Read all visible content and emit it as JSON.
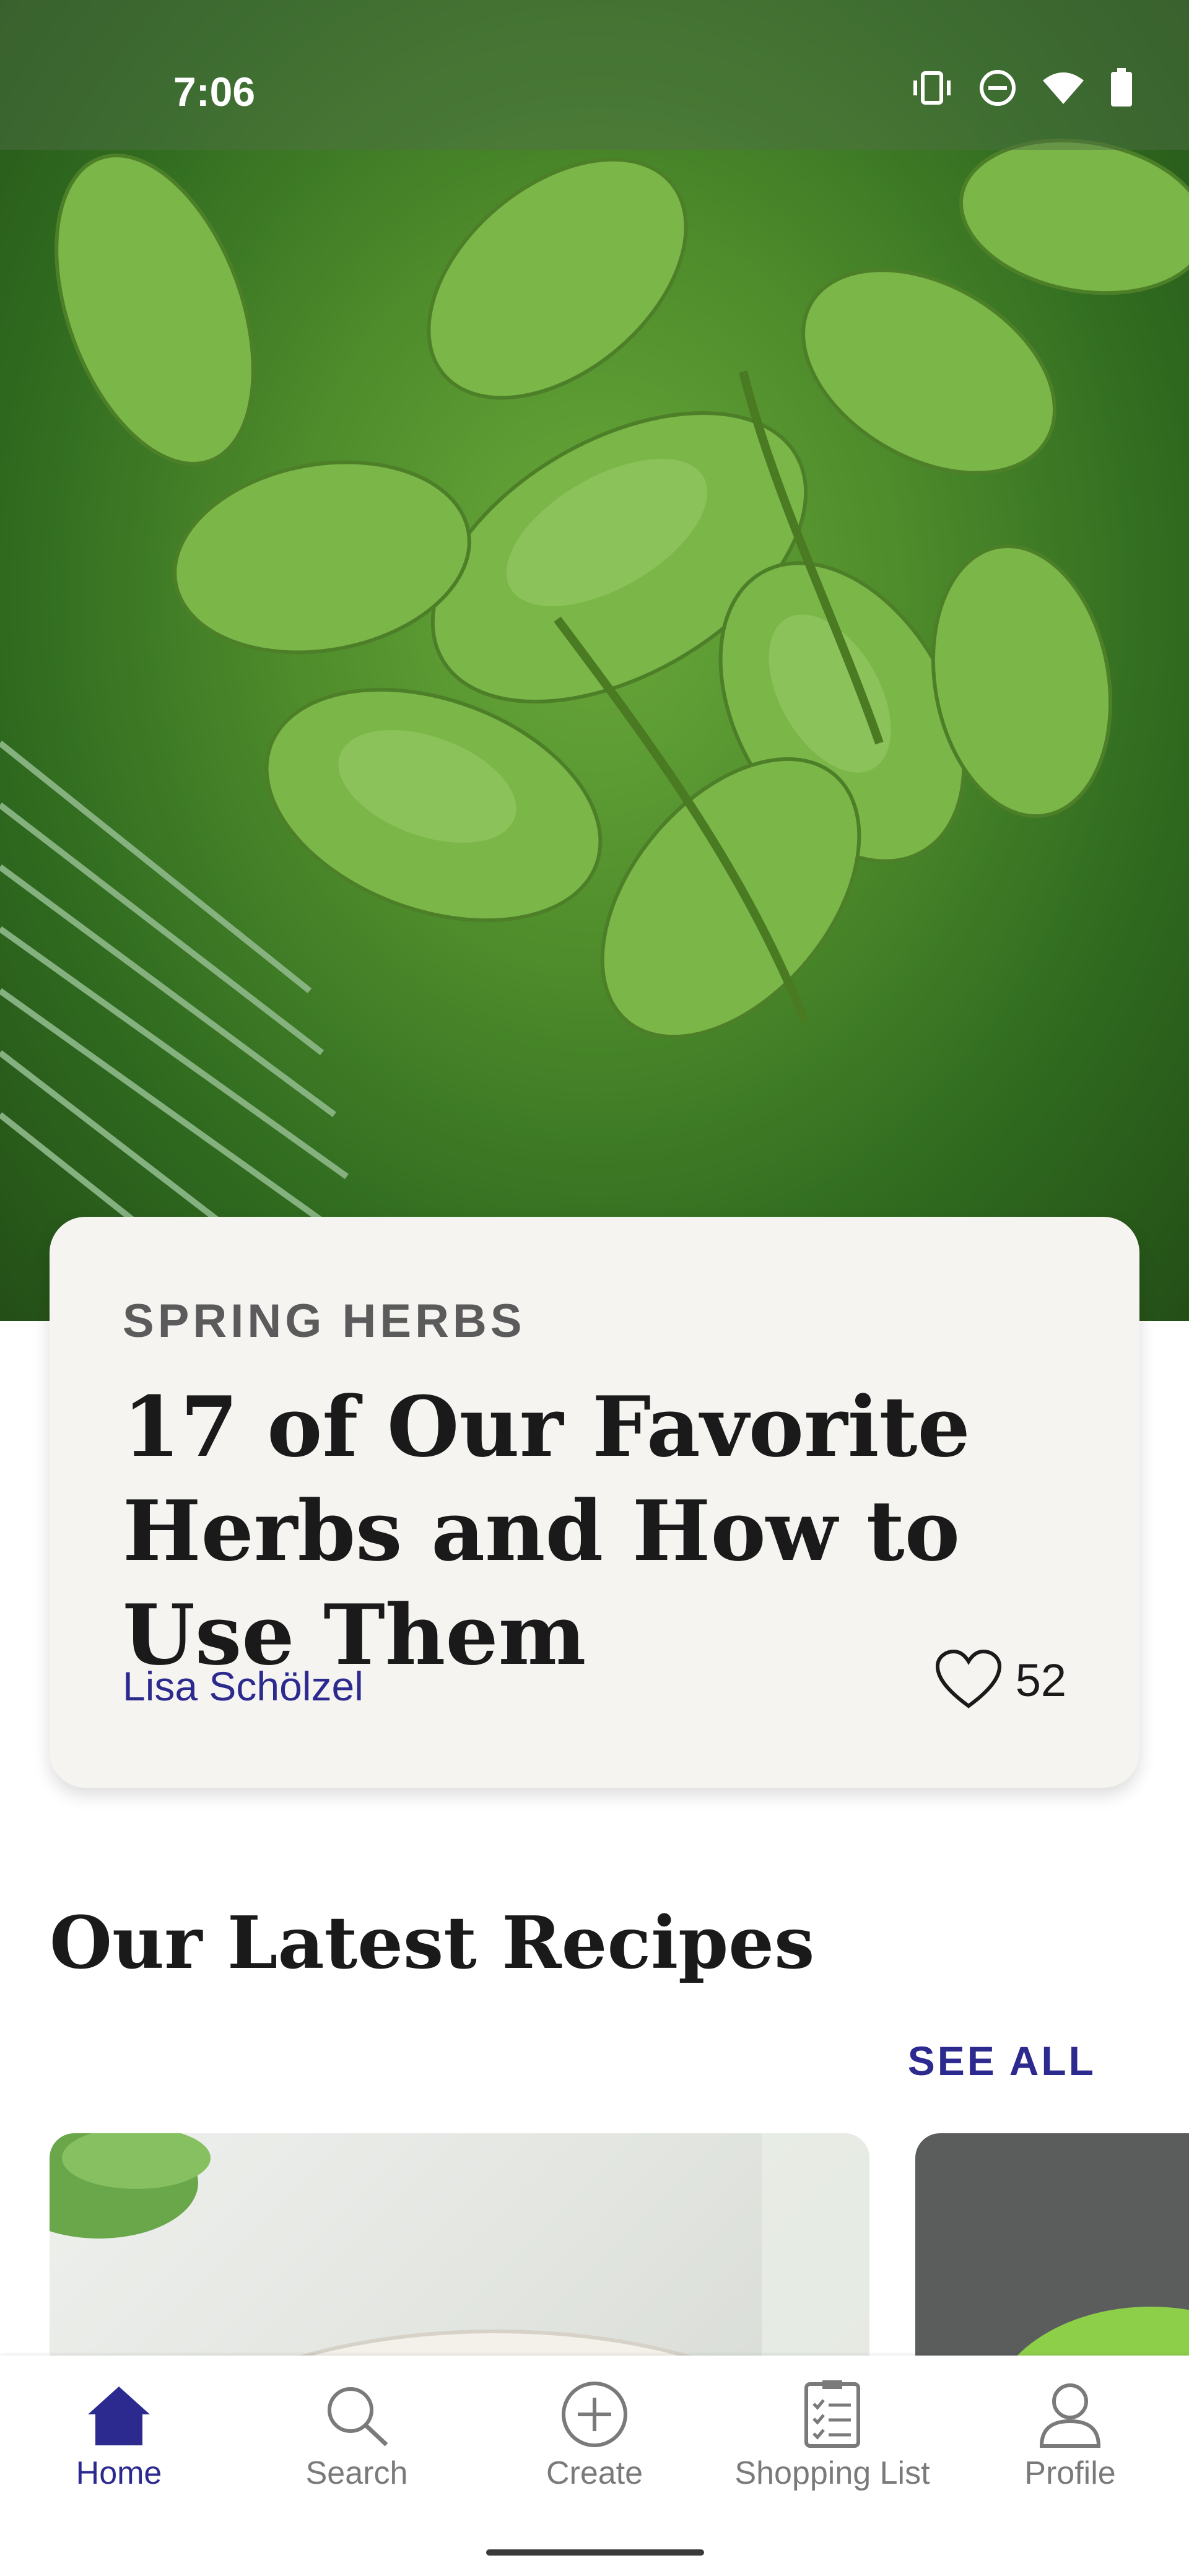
{
  "status_bar": {
    "time": "7:06",
    "icons": [
      "vibrate-icon",
      "do-not-disturb-icon",
      "wifi-icon",
      "battery-icon"
    ]
  },
  "hero": {
    "image": "herbs-photo"
  },
  "feature_card": {
    "kicker": "SPRING HERBS",
    "title": "17 of Our Favorite Herbs and How to Use Them",
    "author": "Lisa Schölzel",
    "like_count": "52",
    "like_icon": "heart-outline-icon"
  },
  "latest": {
    "title": "Our Latest Recipes",
    "see_all": "SEE ALL"
  },
  "bottom_nav": {
    "items": [
      {
        "label": "Home",
        "icon": "home-icon",
        "active": true
      },
      {
        "label": "Search",
        "icon": "search-icon",
        "active": false
      },
      {
        "label": "Create",
        "icon": "plus-circle-icon",
        "active": false
      },
      {
        "label": "Shopping List",
        "icon": "clipboard-list-icon",
        "active": false
      },
      {
        "label": "Profile",
        "icon": "person-icon",
        "active": false
      }
    ]
  },
  "colors": {
    "accent": "#2d2a8f",
    "card_bg": "#f6f4f1",
    "text": "#1a1a1a",
    "inactive_nav": "#7a7a7a"
  }
}
